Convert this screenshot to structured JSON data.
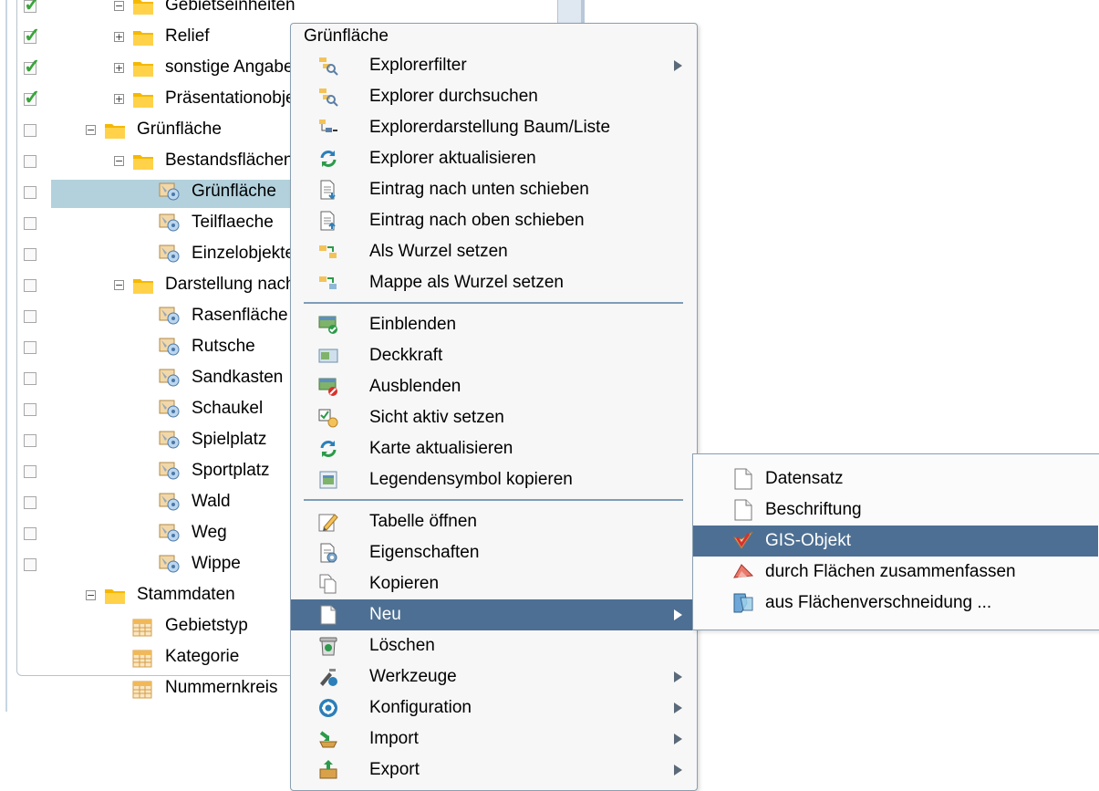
{
  "tree": {
    "rows": [
      {
        "label": "Gebietseinheiten",
        "checked": true
      },
      {
        "label": "Relief",
        "checked": true
      },
      {
        "label": "sonstige Angaben",
        "checked": true
      },
      {
        "label": "Präsentationobjekte",
        "checked": true
      },
      {
        "label": "Grünfläche",
        "checked": false
      },
      {
        "label": "Bestandsflächen",
        "checked": false
      },
      {
        "label": "Grünfläche",
        "checked": false,
        "selected": true
      },
      {
        "label": "Teilflaeche",
        "checked": false
      },
      {
        "label": "Einzelobjekte",
        "checked": false
      },
      {
        "label": "Darstellung nach Art",
        "checked": false
      },
      {
        "label": "Rasenfläche",
        "checked": false
      },
      {
        "label": "Rutsche",
        "checked": false
      },
      {
        "label": "Sandkasten",
        "checked": false
      },
      {
        "label": "Schaukel",
        "checked": false
      },
      {
        "label": "Spielplatz",
        "checked": false
      },
      {
        "label": "Sportplatz",
        "checked": false
      },
      {
        "label": "Wald",
        "checked": false
      },
      {
        "label": "Weg",
        "checked": false
      },
      {
        "label": "Wippe",
        "checked": false
      },
      {
        "label": "Stammdaten"
      },
      {
        "label": "Gebietstyp"
      },
      {
        "label": "Kategorie"
      },
      {
        "label": "Nummernkreis"
      }
    ]
  },
  "context_menu": {
    "header": "Grünfläche",
    "items": [
      {
        "label": "Explorerfilter",
        "icon": "explorer-filter-icon",
        "submenu": true
      },
      {
        "label": "Explorer durchsuchen",
        "icon": "explorer-search-icon"
      },
      {
        "label": "Explorerdarstellung Baum/Liste",
        "icon": "tree-list-icon"
      },
      {
        "label": "Explorer aktualisieren",
        "icon": "refresh-icon"
      },
      {
        "label": "Eintrag nach unten schieben",
        "icon": "move-down-icon"
      },
      {
        "label": "Eintrag nach oben schieben",
        "icon": "move-up-icon"
      },
      {
        "label": "Als Wurzel setzen",
        "icon": "set-root-icon"
      },
      {
        "label": "Mappe als Wurzel setzen",
        "icon": "folder-root-icon"
      },
      {
        "label": "Einblenden",
        "icon": "show-layer-icon"
      },
      {
        "label": "Deckkraft",
        "icon": "opacity-icon"
      },
      {
        "label": "Ausblenden",
        "icon": "hide-layer-icon"
      },
      {
        "label": "Sicht aktiv setzen",
        "icon": "view-active-icon"
      },
      {
        "label": "Karte aktualisieren",
        "icon": "map-refresh-icon"
      },
      {
        "label": "Legendensymbol kopieren",
        "icon": "legend-copy-icon"
      },
      {
        "label": "Tabelle öffnen",
        "icon": "table-open-icon"
      },
      {
        "label": "Eigenschaften",
        "icon": "properties-icon"
      },
      {
        "label": "Kopieren",
        "icon": "copy-icon"
      },
      {
        "label": "Neu",
        "icon": "new-document-icon",
        "submenu": true,
        "active": true
      },
      {
        "label": "Löschen",
        "icon": "trash-icon"
      },
      {
        "label": "Werkzeuge",
        "icon": "tools-icon",
        "submenu": true
      },
      {
        "label": "Konfiguration",
        "icon": "config-icon",
        "submenu": true
      },
      {
        "label": "Import",
        "icon": "import-icon",
        "submenu": true
      },
      {
        "label": "Export",
        "icon": "export-icon",
        "submenu": true
      }
    ]
  },
  "submenu": {
    "items": [
      {
        "label": "Datensatz",
        "icon": "blank-document-icon"
      },
      {
        "label": "Beschriftung",
        "icon": "blank-document-icon"
      },
      {
        "label": "GIS-Objekt",
        "icon": "gis-object-icon",
        "active": true
      },
      {
        "label": "durch Flächen zusammenfassen",
        "icon": "merge-areas-icon"
      },
      {
        "label": "aus Flächenverschneidung ...",
        "icon": "intersect-areas-icon"
      }
    ]
  },
  "colors": {
    "highlight": "#4d6f93",
    "tree_selection": "#b3d1dc",
    "separator": "#7f9db9",
    "check": "#3aa43a",
    "folder": "#f5b800"
  }
}
